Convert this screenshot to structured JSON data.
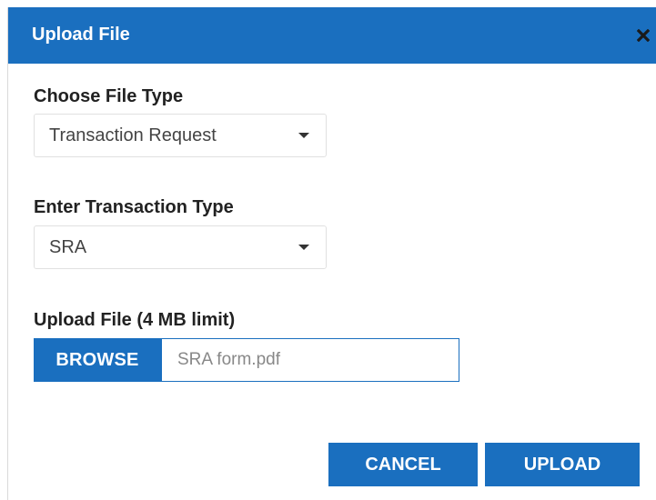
{
  "dialog": {
    "title": "Upload File",
    "close_icon": "close-icon"
  },
  "colors": {
    "accent": "#1a6fbf",
    "label_text": "#222222",
    "field_text": "#444444",
    "placeholder_text": "#888888"
  },
  "file_type": {
    "label": "Choose File Type",
    "selected": "Transaction Request",
    "icon": "chevron-down-icon"
  },
  "transaction_type": {
    "label": "Enter Transaction Type",
    "selected": "SRA",
    "icon": "chevron-down-icon"
  },
  "upload": {
    "label": "Upload File (4 MB limit)",
    "browse_label": "BROWSE",
    "file_name": "SRA form.pdf"
  },
  "actions": {
    "cancel_label": "CANCEL",
    "upload_label": "UPLOAD"
  }
}
